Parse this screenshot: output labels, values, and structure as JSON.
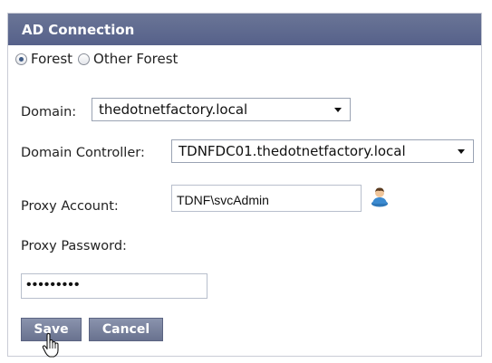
{
  "header": {
    "title": "AD Connection"
  },
  "forest_options": [
    {
      "label": "Forest",
      "checked": true
    },
    {
      "label": "Other Forest",
      "checked": false
    }
  ],
  "domain": {
    "label": "Domain:",
    "value": "thedotnetfactory.local"
  },
  "domain_controller": {
    "label": "Domain Controller:",
    "value": "TDNFDC01.thedotnetfactory.local"
  },
  "proxy_account": {
    "label": "Proxy Account:",
    "value": "TDNF\\svcAdmin",
    "icon": "user-lookup-icon"
  },
  "proxy_password": {
    "label": "Proxy Password:",
    "value": "•••••••••"
  },
  "buttons": {
    "save": "Save",
    "cancel": "Cancel"
  }
}
